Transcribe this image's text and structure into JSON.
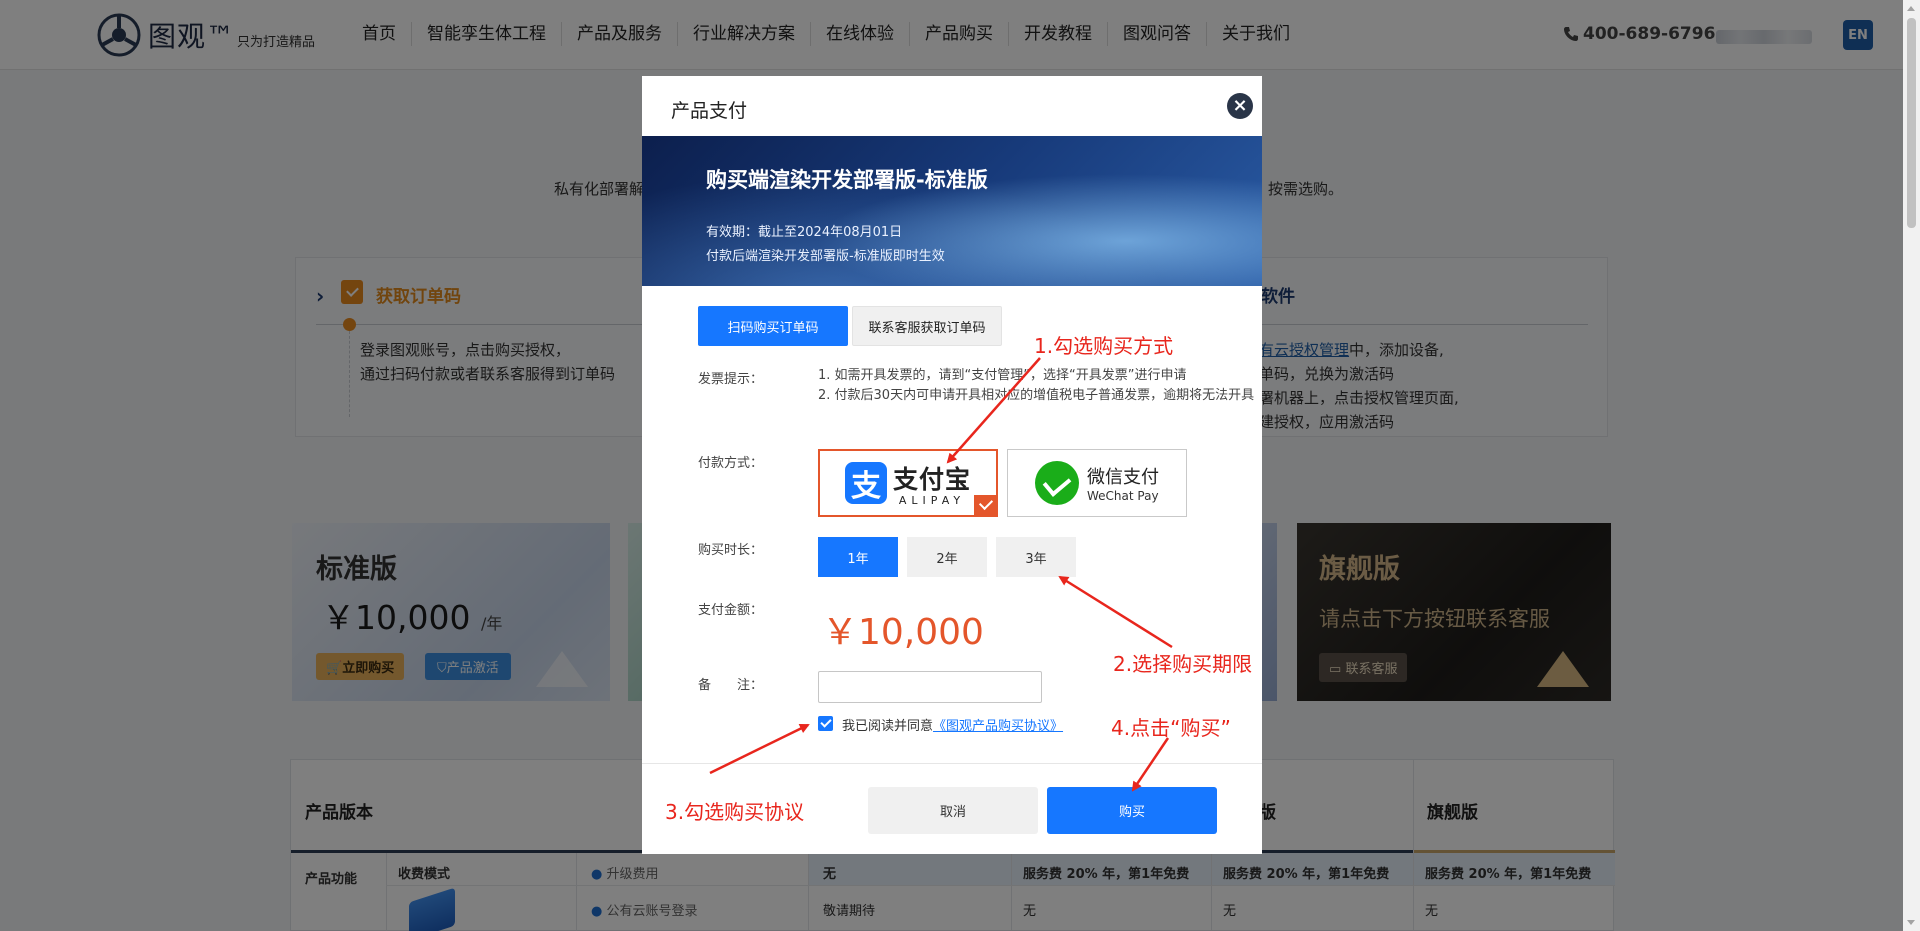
{
  "header": {
    "logo_text": "图观™",
    "slogan": "只为打造精品",
    "nav": [
      "首页",
      "智能孪生体工程",
      "产品及服务",
      "行业解决方案",
      "在线体验",
      "产品购买",
      "开发教程",
      "图观问答",
      "关于我们"
    ],
    "phone": "400-689-6796",
    "lang": "EN"
  },
  "background": {
    "intro_left": "私有化部署解",
    "intro_right": "按需选购。",
    "step1": {
      "title": "获取订单码",
      "lines": [
        "登录图观账号，点击购买授权，",
        "通过扫码付款或者联系客服得到订单码"
      ]
    },
    "step3": {
      "title_tail": "软件",
      "link": "有云授权管理",
      "line1_tail": "中，添加设备,",
      "line2": "单码，兑换为激活码",
      "line3": "署机器上，点击授权管理页面,",
      "line4": "建授权，应用激活码"
    },
    "card_standard": {
      "title": "标准版",
      "price": "￥10,000",
      "unit": "/年",
      "buy_label": "立即购买",
      "activate_label": "产品激活"
    },
    "card_flagship": {
      "title": "旗舰版",
      "subtitle": "请点击下方按钮联系客服",
      "contact_label": "联系客服"
    },
    "table": {
      "header_version": "产品版本",
      "header_col5": "版",
      "header_flagship": "旗舰版",
      "row_label": "产品功能",
      "row1": {
        "mode": "收费模式",
        "item": "升级费用",
        "col_a": "无",
        "col_b": "服务费 20% 年，第1年免费",
        "col_c": "服务费 20% 年，第1年免费",
        "col_d": "服务费 20% 年，第1年免费"
      },
      "row2": {
        "item": "公有云账号登录",
        "col_a": "敬请期待",
        "col_b": "无",
        "col_c": "无",
        "col_d": "无"
      }
    }
  },
  "modal": {
    "title": "产品支付",
    "banner": {
      "product_name": "购买端渲染开发部署版-标准版",
      "validity": "有效期：截止至2024年08月01日",
      "note": "付款后端渲染开发部署版-标准版即时生效"
    },
    "tabs": {
      "scan": "扫码购买订单码",
      "service": "联系客服获取订单码"
    },
    "invoice": {
      "label": "发票提示：",
      "line1": "1. 如需开具发票的，请到“支付管理”，选择“开具发票”进行申请",
      "line2": "2. 付款后30天内可申请开具相对应的增值税电子普通发票，逾期将无法开具"
    },
    "payment": {
      "label": "付款方式：",
      "alipay_icon": "支",
      "alipay_cn": "支付宝",
      "alipay_en": "ALIPAY",
      "wechat_cn": "微信支付",
      "wechat_en": "WeChat Pay"
    },
    "duration": {
      "label": "购买时长：",
      "options": [
        "1年",
        "2年",
        "3年"
      ],
      "selected": "1年"
    },
    "amount": {
      "label": "支付金额：",
      "value": "￥10,000"
    },
    "remark": {
      "label": "备　　注：",
      "value": ""
    },
    "agreement": {
      "text": "我已阅读并同意",
      "link": "《图观产品购买协议》",
      "checked": true
    },
    "buttons": {
      "cancel": "取消",
      "purchase": "购买"
    }
  },
  "annotations": [
    "1.勾选购买方式",
    "2.选择购买期限",
    "3.勾选购买协议",
    "4.点击“购买”"
  ],
  "colors": {
    "primary": "#1677ff",
    "accent": "#e4562b",
    "annotation": "#e8261d"
  }
}
